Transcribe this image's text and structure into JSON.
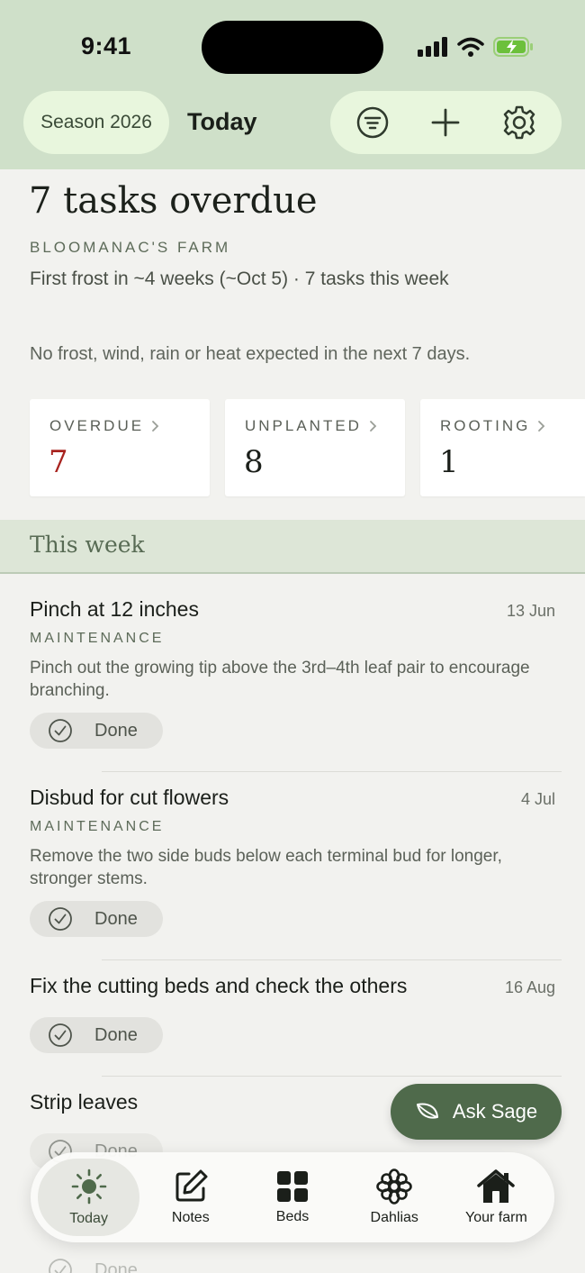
{
  "status_bar": {
    "time": "9:41"
  },
  "header": {
    "season_label": "Season 2026",
    "title": "Today",
    "actions": [
      {
        "name": "filter",
        "icon": "filter-icon"
      },
      {
        "name": "add",
        "icon": "plus-icon"
      },
      {
        "name": "settings",
        "icon": "gear-icon"
      }
    ]
  },
  "summary": {
    "title": "7 tasks overdue",
    "farm_name": "BLOOMANAC'S FARM",
    "frost_line": "First frost in ~4 weeks (~Oct 5) · 7 tasks this week",
    "weather_line": "No frost, wind, rain or heat expected in the next 7 days."
  },
  "stats": [
    {
      "label": "OVERDUE",
      "value": "7"
    },
    {
      "label": "UNPLANTED",
      "value": "8"
    },
    {
      "label": "ROOTING",
      "value": "1"
    }
  ],
  "this_week": {
    "heading": "This week",
    "tasks": [
      {
        "title": "Pinch at 12 inches",
        "date": "13 Jun",
        "category": "MAINTENANCE",
        "description": "Pinch out the growing tip above the 3rd–4th leaf pair to encourage branching.",
        "done_label": "Done"
      },
      {
        "title": "Disbud for cut flowers",
        "date": "4 Jul",
        "category": "MAINTENANCE",
        "description": "Remove the two side buds below each terminal bud for longer, stronger stems.",
        "done_label": "Done"
      },
      {
        "title": "Fix the cutting beds and check the others",
        "date": "16 Aug",
        "done_label": "Done"
      },
      {
        "title": "Strip leaves",
        "done_label": "Done"
      },
      {
        "done_label": "Done"
      }
    ]
  },
  "ask_sage": {
    "label": "Ask Sage"
  },
  "tabbar": {
    "tabs": [
      {
        "label": "Today",
        "icon": "sun-icon",
        "active": true
      },
      {
        "label": "Notes",
        "icon": "edit-icon"
      },
      {
        "label": "Beds",
        "icon": "grid-icon"
      },
      {
        "label": "Dahlias",
        "icon": "flower-icon"
      },
      {
        "label": "Your farm",
        "icon": "house-icon"
      }
    ]
  },
  "colors": {
    "header_bg": "#cfe0c9",
    "pill_bg": "#e8f6dd",
    "accent": "#4f6a4b",
    "overdue_red": "#a8231f",
    "page_bg": "#f2f2ef"
  }
}
